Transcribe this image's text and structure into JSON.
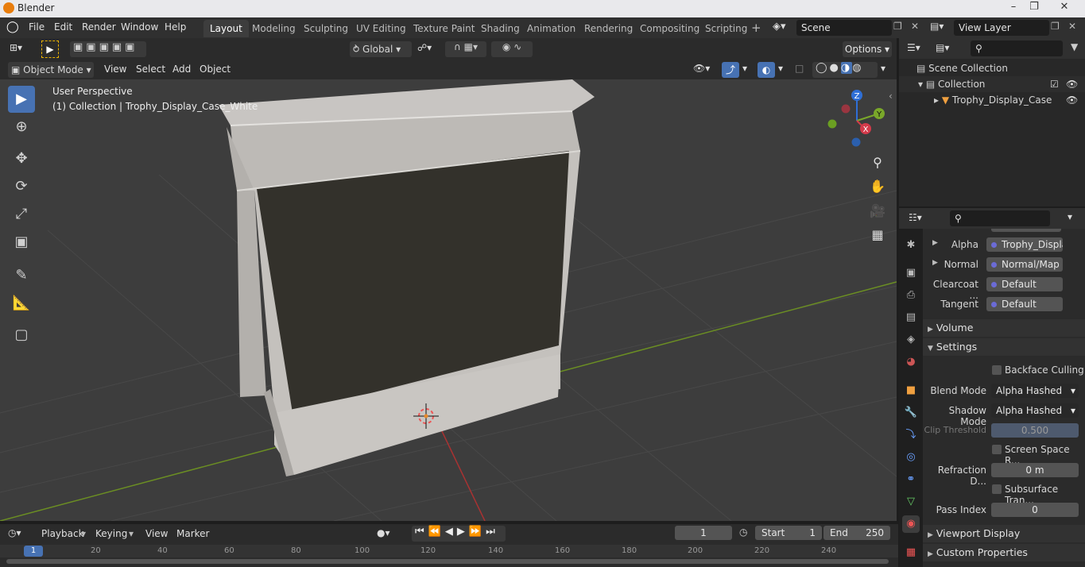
{
  "app": {
    "title": "Blender"
  },
  "menu": [
    "File",
    "Edit",
    "Render",
    "Window",
    "Help"
  ],
  "workspaces": [
    {
      "label": "Layout",
      "active": true
    },
    {
      "label": "Modeling"
    },
    {
      "label": "Sculpting"
    },
    {
      "label": "UV Editing"
    },
    {
      "label": "Texture Paint"
    },
    {
      "label": "Shading"
    },
    {
      "label": "Animation"
    },
    {
      "label": "Rendering"
    },
    {
      "label": "Compositing"
    },
    {
      "label": "Scripting"
    }
  ],
  "scene": {
    "name": "Scene"
  },
  "view_layer": {
    "name": "View Layer"
  },
  "viewport_header": {
    "transform_orientation": "Global",
    "options_label": "Options"
  },
  "viewport_menu": {
    "mode": "Object Mode",
    "items": [
      "View",
      "Select",
      "Add",
      "Object"
    ]
  },
  "viewport": {
    "perspective": "User Perspective",
    "collection_info": "(1) Collection | Trophy_Display_Case_White"
  },
  "gizmo": {
    "x": "X",
    "y": "Y",
    "z": "Z"
  },
  "outliner": {
    "scene_collection": "Scene Collection",
    "collection": "Collection",
    "object": "Trophy_Display_Case"
  },
  "properties": {
    "inputs": [
      {
        "label": "Alpha",
        "value": "Trophy_Displa..."
      },
      {
        "label": "Normal",
        "value": "Normal/Map"
      },
      {
        "label": "Clearcoat ...",
        "value": "Default"
      },
      {
        "label": "Tangent",
        "value": "Default"
      }
    ],
    "volume_label": "Volume",
    "settings_label": "Settings",
    "backface_culling": "Backface Culling",
    "blend_mode_label": "Blend Mode",
    "blend_mode": "Alpha Hashed",
    "shadow_mode_label": "Shadow Mode",
    "shadow_mode": "Alpha Hashed",
    "clip_threshold_label": "Clip Threshold",
    "clip_threshold": "0.500",
    "screen_space": "Screen Space R...",
    "refraction_label": "Refraction D...",
    "refraction": "0 m",
    "subsurface": "Subsurface Tran...",
    "pass_index_label": "Pass Index",
    "pass_index": "0",
    "viewport_display": "Viewport Display",
    "custom_properties": "Custom Properties"
  },
  "timeline": {
    "menus": [
      "Playback",
      "Keying",
      "View",
      "Marker"
    ],
    "current_frame": "1",
    "start_label": "Start",
    "start": "1",
    "end_label": "End",
    "end": "250",
    "ruler": [
      "1",
      "20",
      "40",
      "60",
      "80",
      "100",
      "120",
      "140",
      "160",
      "180",
      "200",
      "220",
      "240"
    ]
  },
  "colors": {
    "accent": "#4772b3",
    "x_axis": "#ff3352",
    "y_axis": "#8bdc00",
    "z_axis": "#2890ff"
  }
}
